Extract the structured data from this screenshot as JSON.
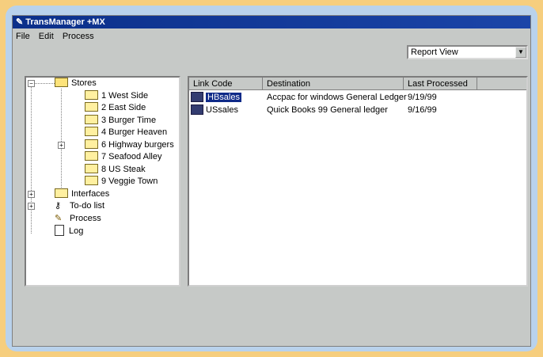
{
  "window": {
    "title": "TransManager +MX"
  },
  "menu": [
    "File",
    "Edit",
    "Process"
  ],
  "view_select": {
    "value": "Report View"
  },
  "tree": {
    "stores_label": "Stores",
    "stores": [
      "1 West Side",
      "2 East Side",
      "3 Burger Time",
      "4 Burger Heaven",
      "6 Highway burgers",
      "7 Seafood Alley",
      "8 US Steak",
      "9 Veggie Town"
    ],
    "interfaces_label": "Interfaces",
    "todo_label": "To-do list",
    "process_label": "Process",
    "log_label": "Log"
  },
  "list": {
    "columns": [
      "Link Code",
      "Destination",
      "Last Processed"
    ],
    "rows": [
      {
        "code": "HBsales",
        "destination": "Accpac for windows General Ledger",
        "date": "9/19/99",
        "selected": true
      },
      {
        "code": "USsales",
        "destination": "Quick Books 99 General ledger",
        "date": "9/16/99",
        "selected": false
      }
    ]
  },
  "colors": {
    "titlebar": "#0b2f8a",
    "selection": "#0f2a88",
    "frame": "#b9d2ec",
    "background": "#f6ce7e"
  }
}
